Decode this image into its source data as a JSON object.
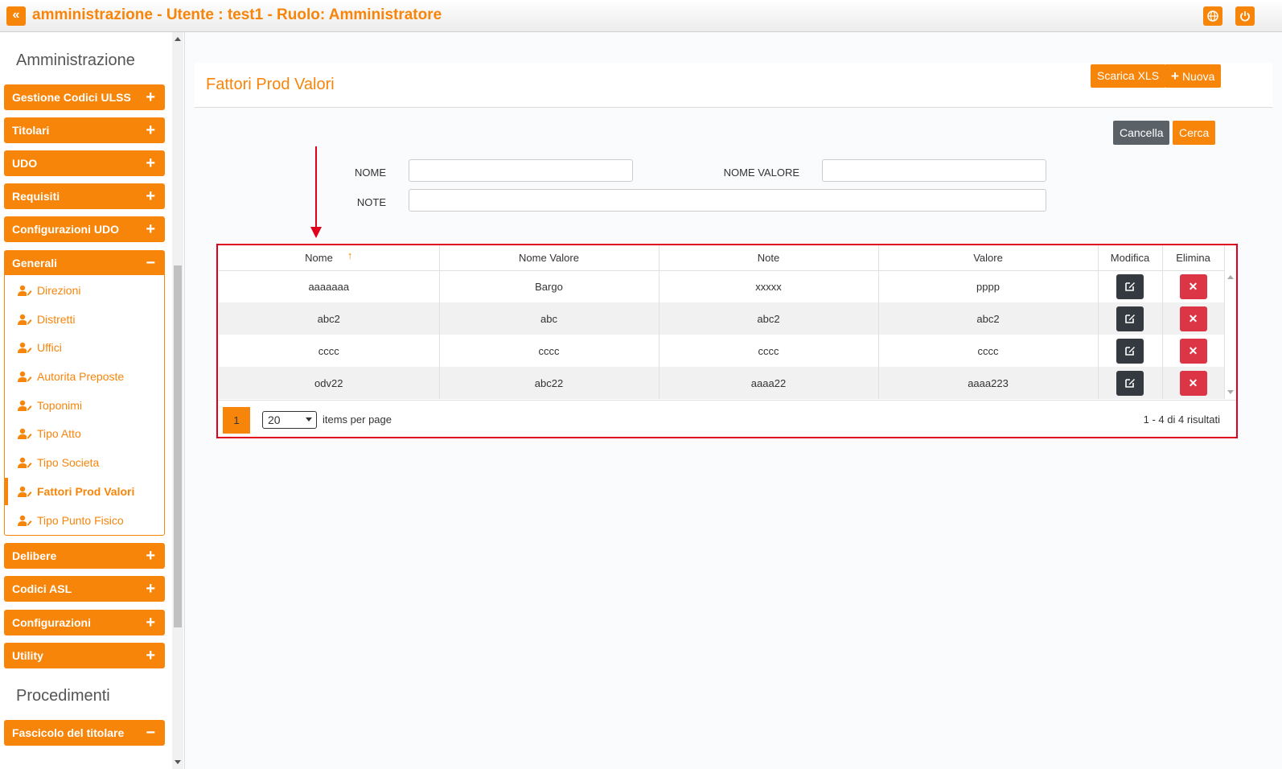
{
  "topbar": {
    "title": "amministrazione - Utente : test1 - Ruolo: Amministratore",
    "collapse_icon": "double-chevron-left-icon",
    "globe_icon": "globe-icon",
    "power_icon": "power-icon",
    "accent": "#f7850a"
  },
  "sidebar": {
    "section1": "Amministrazione",
    "menus": [
      {
        "label": "Gestione Codici ULSS",
        "sign": "+"
      },
      {
        "label": "Titolari",
        "sign": "+"
      },
      {
        "label": "UDO",
        "sign": "+"
      },
      {
        "label": "Requisiti",
        "sign": "+"
      },
      {
        "label": "Configurazioni UDO",
        "sign": "+"
      },
      {
        "label": "Generali",
        "sign": "−"
      }
    ],
    "subitems": [
      {
        "label": "Direzioni"
      },
      {
        "label": "Distretti"
      },
      {
        "label": "Uffici"
      },
      {
        "label": "Autorita Preposte"
      },
      {
        "label": "Toponimi"
      },
      {
        "label": "Tipo Atto"
      },
      {
        "label": "Tipo Societa"
      },
      {
        "label": "Fattori Prod Valori"
      },
      {
        "label": "Tipo Punto Fisico"
      }
    ],
    "menus2": [
      {
        "label": "Delibere",
        "sign": "+"
      },
      {
        "label": "Codici ASL",
        "sign": "+"
      },
      {
        "label": "Configurazioni",
        "sign": "+"
      },
      {
        "label": "Utility",
        "sign": "+"
      }
    ],
    "section2": "Procedimenti",
    "menus3": [
      {
        "label": "Fascicolo del titolare",
        "sign": "−"
      }
    ]
  },
  "page": {
    "title": "Fattori Prod Valori",
    "download_label": "Scarica XLS",
    "new_label": "Nuova",
    "clear_label": "Cancella",
    "search_label": "Cerca"
  },
  "filters": {
    "nome_label": "NOME",
    "nome_valore_label": "NOME VALORE",
    "note_label": "NOTE",
    "nome_value": "",
    "nome_valore_value": "",
    "note_value": ""
  },
  "table": {
    "headers": [
      "Nome",
      "Nome Valore",
      "Note",
      "Valore",
      "Modifica",
      "Elimina"
    ],
    "rows": [
      [
        "aaaaaaa",
        "Bargo",
        "xxxxx",
        "pppp"
      ],
      [
        "abc2",
        "abc",
        "abc2",
        "abc2"
      ],
      [
        "cccc",
        "cccc",
        "cccc",
        "cccc"
      ],
      [
        "odv22",
        "abc22",
        "aaaa22",
        "aaaa223"
      ]
    ],
    "sort_icon": "↑",
    "delete_symbol": "✕"
  },
  "pager": {
    "current_page": "1",
    "page_size": "20",
    "items_per_page": "items per page",
    "results": "1 - 4 di 4 risultati"
  }
}
